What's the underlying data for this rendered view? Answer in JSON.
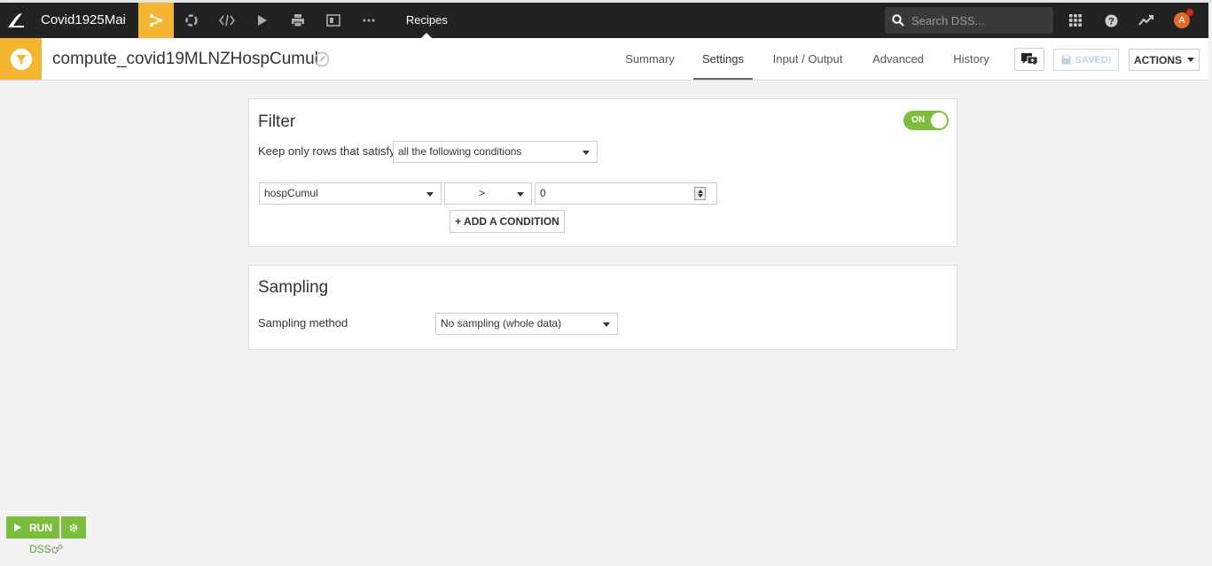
{
  "nav": {
    "project_name": "Covid1925Mai",
    "current_section": "Recipes",
    "search_placeholder": "Search DSS...",
    "avatar_initial": "A"
  },
  "header": {
    "recipe_title": "compute_covid19MLNZHospCumul",
    "tabs": [
      "Summary",
      "Settings",
      "Input / Output",
      "Advanced",
      "History"
    ],
    "active_tab": "Settings",
    "saved_label": "SAVED!",
    "actions_label": "ACTIONS"
  },
  "filter": {
    "title": "Filter",
    "toggle_label": "ON",
    "keep_rows_label": "Keep only rows that satisfy",
    "mode_value": "all the following conditions",
    "condition": {
      "column": "hospCumul",
      "operator": ">",
      "value": "0"
    },
    "add_condition_label": "+ ADD A CONDITION"
  },
  "sampling": {
    "title": "Sampling",
    "method_label": "Sampling method",
    "method_value": "No sampling (whole data)"
  },
  "run": {
    "run_label": "RUN",
    "engine_label": "DSS"
  },
  "colors": {
    "topbar": "#222222",
    "accent_yellow": "#f5b731",
    "run_green": "#7dbd3e"
  }
}
